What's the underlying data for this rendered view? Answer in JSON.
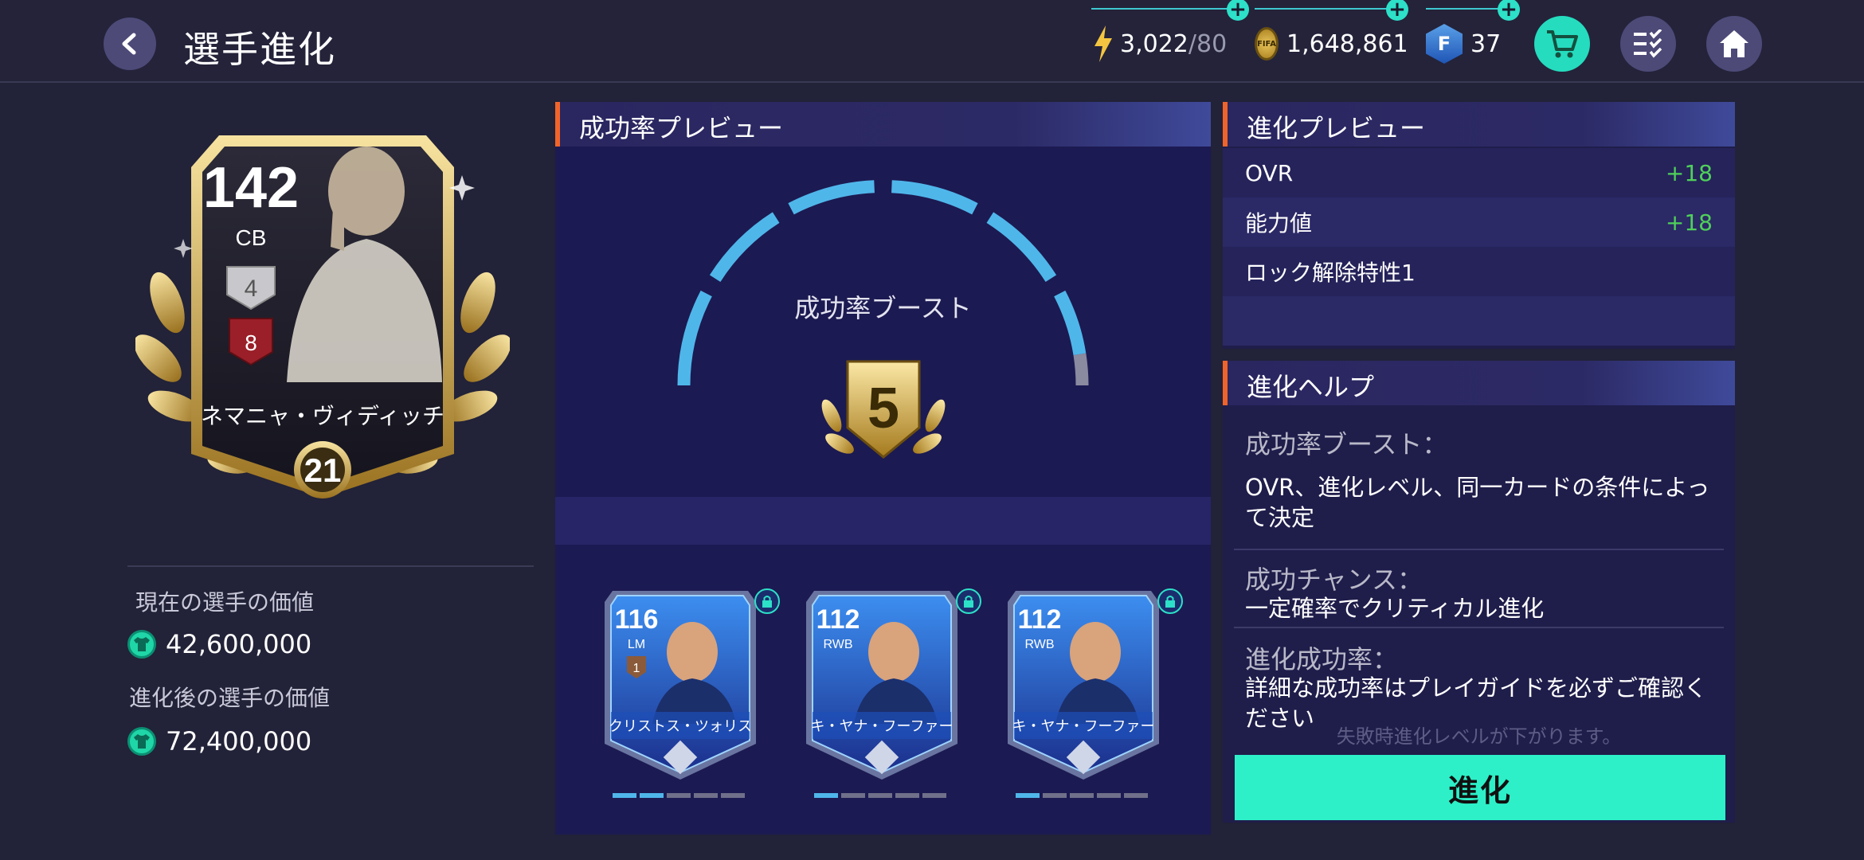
{
  "header": {
    "title": "選手進化",
    "energy": "3,022",
    "energy_max": "/80",
    "coins": "1,648,861",
    "fifa_points": "37",
    "coin_icon_text": "FIFA",
    "points_icon_text": "F"
  },
  "player": {
    "ovr": "142",
    "position": "CB",
    "rank": "4",
    "level": "8",
    "name": "ネマニャ・ヴィディッチ",
    "evo_level": "21"
  },
  "values": {
    "current_label": "現在の選手の価値",
    "current_value": "42,600,000",
    "after_label": "進化後の選手の価値",
    "after_value": "72,400,000"
  },
  "success_preview": {
    "title": "成功率プレビュー",
    "boost_label": "成功率ブースト",
    "boost_value": "5",
    "gauge_fraction": 0.95
  },
  "material_cards": [
    {
      "ovr": "116",
      "position": "LM",
      "rank": "1",
      "name": "クリストス・ツォリス",
      "progress_segments": 2,
      "total_segments": 5
    },
    {
      "ovr": "112",
      "position": "RWB",
      "rank": "",
      "name": "キ・ヤナ・フーファー",
      "progress_segments": 1,
      "total_segments": 5
    },
    {
      "ovr": "112",
      "position": "RWB",
      "rank": "",
      "name": "キ・ヤナ・フーファー",
      "progress_segments": 1,
      "total_segments": 5
    }
  ],
  "evo_preview": {
    "title": "進化プレビュー",
    "rows": [
      {
        "label": "OVR",
        "value": "+18"
      },
      {
        "label": "能力値",
        "value": "+18"
      },
      {
        "label": "ロック解除特性1",
        "value": ""
      }
    ]
  },
  "help": {
    "title": "進化ヘルプ",
    "sections": [
      {
        "title": "成功率ブースト：",
        "body": "OVR、進化レベル、同一カードの条件によって決定"
      },
      {
        "title": "成功チャンス：",
        "body": "一定確率でクリティカル進化"
      },
      {
        "title": "進化成功率：",
        "body": "詳細な成功率はプレイガイドを必ずご確認ください"
      }
    ],
    "fail_note": "失敗時進化レベルが下がります。"
  },
  "evolve_button": "進化",
  "colors": {
    "accent_teal": "#2df0c8",
    "gain_green": "#4fd05a",
    "header_orange": "#f0642a",
    "gauge_blue": "#4fb6ea"
  }
}
